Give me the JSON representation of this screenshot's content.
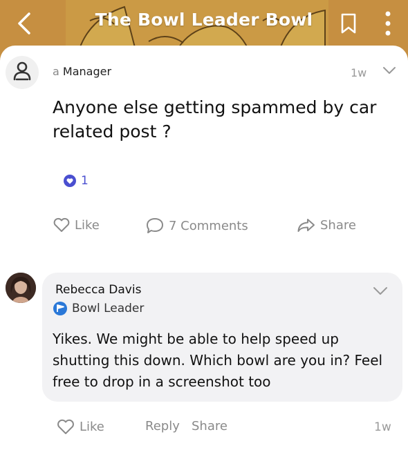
{
  "header": {
    "title": "The Bowl Leader Bowl",
    "back_icon": "chevron-left-icon",
    "bookmark_icon": "bookmark-icon",
    "more_icon": "more-vertical-icon",
    "colors": {
      "banner": "#e2a34a",
      "title": "#ffffff"
    }
  },
  "post": {
    "author_prefix": "a",
    "author_role": "Manager",
    "timestamp": "1w",
    "text": "Anyone else getting spammed by car related post ?",
    "reaction_count": "1",
    "actions": {
      "like": "Like",
      "comments": "7 Comments",
      "share": "Share"
    }
  },
  "comment": {
    "author": "Rebecca Davis",
    "badge": "Bowl Leader",
    "text": "Yikes. We might be able to help speed up shutting this down. Which bowl are you in? Feel free to drop in a screenshot too",
    "actions": {
      "like": "Like",
      "reply": "Reply",
      "share": "Share"
    },
    "timestamp": "1w"
  },
  "colors": {
    "accent": "#4a4fd0",
    "badge_blue": "#2a78d8",
    "muted": "#8a8a8a",
    "bubble": "#f2f2f4"
  }
}
